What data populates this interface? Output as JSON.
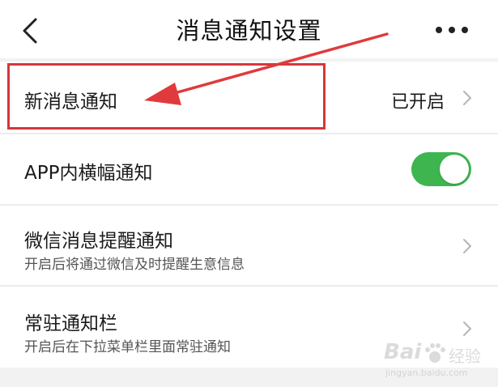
{
  "header": {
    "title": "消息通知设置",
    "back_icon": "chevron-left-icon",
    "more_icon": "more-horizontal-icon"
  },
  "settings": {
    "new_message": {
      "label": "新消息通知",
      "value": "已开启"
    },
    "in_app_banner": {
      "label": "APP内横幅通知",
      "toggle_on": true
    },
    "wechat_reminder": {
      "label": "微信消息提醒通知",
      "description": "开启后将通过微信及时提醒生意信息"
    },
    "persistent_bar": {
      "label": "常驻通知栏",
      "description": "开启后在下拉菜单栏里面常驻通知"
    }
  },
  "annotation": {
    "highlight_color": "#d4373b"
  },
  "colors": {
    "toggle_on": "#3eb54f",
    "background": "#f2f2f2"
  },
  "watermark": {
    "brand": "Bai",
    "cn": "经验",
    "url": "jingyan.baidu.com"
  }
}
